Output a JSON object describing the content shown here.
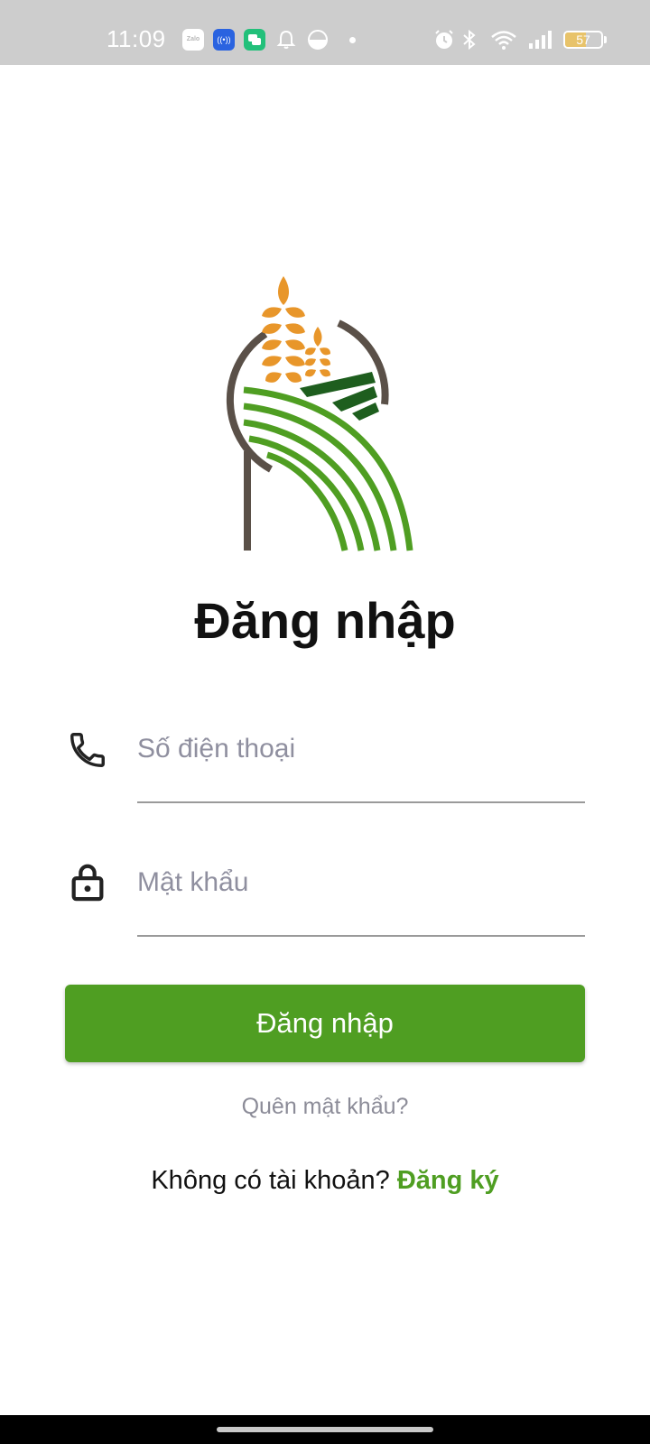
{
  "status_bar": {
    "time": "11:09",
    "zalo_label": "Zalo",
    "battery_percent": 57,
    "battery_label": "57",
    "icons": [
      "zalo-icon",
      "radio-icon",
      "chat-icon",
      "bell-icon",
      "half-circle-icon",
      "dot-icon",
      "alarm-icon",
      "bluetooth-icon",
      "wifi-icon",
      "signal-icon",
      "battery-icon"
    ]
  },
  "logo": {
    "icon": "wheat-field-logo"
  },
  "title": "Đăng nhập",
  "phone_field": {
    "icon": "phone-icon",
    "placeholder": "Số điện thoại",
    "value": ""
  },
  "password_field": {
    "icon": "lock-icon",
    "placeholder": "Mật khẩu",
    "value": ""
  },
  "login_button": {
    "label": "Đăng nhập"
  },
  "forgot_password": "Quên mật khẩu?",
  "signup": {
    "prompt": "Không có tài khoản?",
    "link": "Đăng ký"
  },
  "colors": {
    "accent": "#4f9e22",
    "status_bar": "#cdcdcd",
    "wheat": "#e8962a",
    "dark_green": "#1e5e1e",
    "stem": "#5a5048"
  }
}
